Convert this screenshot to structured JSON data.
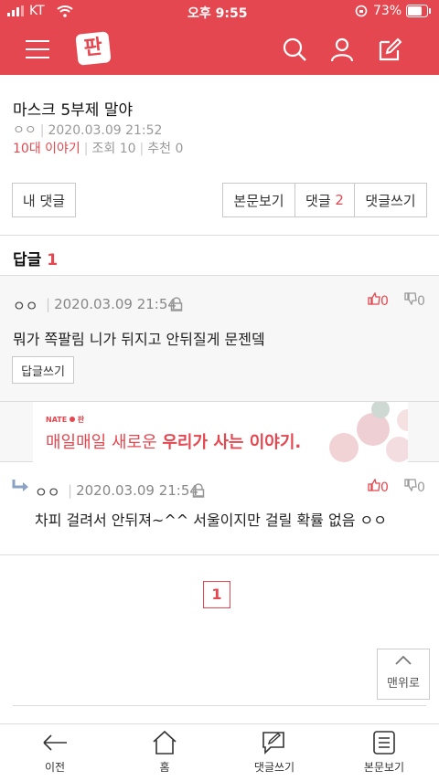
{
  "status_bar": {
    "carrier": "KT",
    "time": "오후 9:55",
    "battery": "73%"
  },
  "app": {
    "logo_text": "판",
    "accent": "#e4474f"
  },
  "post": {
    "title": "마스크 5부제 말야",
    "author": "ㅇㅇ",
    "date": "2020.03.09 21:52",
    "category": "10대 이야기",
    "views_label": "조회 10",
    "recommend_label": "추천 0"
  },
  "actions": {
    "my_comments": "내 댓글",
    "view_body": "본문보기",
    "comments_label": "댓글",
    "comments_count": "2",
    "write_comment": "댓글쓰기"
  },
  "replies": {
    "label": "답글",
    "count": "1"
  },
  "comments": [
    {
      "author": "ㅇㅇ",
      "date": "2020.03.09 21:54",
      "text": "뭐가 쪽팔림 니가 뒤지고 안뒤질게 문젠뎈",
      "likes": "0",
      "dislikes": "0",
      "reply_button": "답글쓰기"
    },
    {
      "author": "ㅇㅇ",
      "date": "2020.03.09 21:54",
      "text": "차피 걸려서 안뒤져~^^ 서울이지만 걸릴 확률 없음 ㅇㅇ",
      "likes": "0",
      "dislikes": "0"
    }
  ],
  "ad": {
    "brand": "NATE",
    "brand_sub": "판",
    "text_plain": "매일매일 새로운 ",
    "text_bold": "우리가 사는 이야기."
  },
  "pagination": {
    "current": "1"
  },
  "to_top": {
    "label": "맨위로"
  },
  "bottom_nav": [
    {
      "label": "이전",
      "icon": "arrow-left-icon"
    },
    {
      "label": "홈",
      "icon": "home-icon"
    },
    {
      "label": "댓글쓰기",
      "icon": "comment-write-icon"
    },
    {
      "label": "본문보기",
      "icon": "document-icon"
    }
  ]
}
